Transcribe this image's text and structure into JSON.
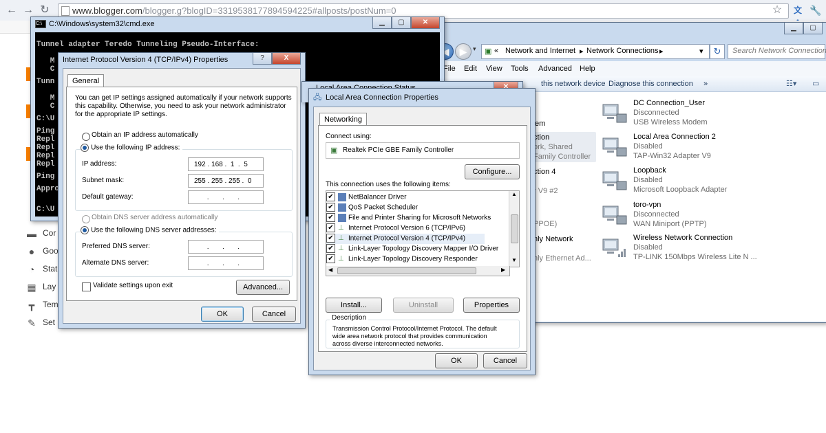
{
  "browser": {
    "url_host": "www.blogger.com",
    "url_rest": "/blogger.g?blogID=3319538177894594225#allposts/postNum=0"
  },
  "blogger_sidebar": {
    "items": [
      "Comments",
      "Google+",
      "Stats",
      "Layout",
      "Template",
      "Settings"
    ],
    "items_visible": [
      "Cor",
      "Goo",
      "Stat",
      "Lay",
      "Tem",
      "Set"
    ]
  },
  "cmd": {
    "title": "C:\\Windows\\system32\\cmd.exe",
    "lines": [
      "Tunnel adapter Teredo Tunneling Pseudo-Interface:",
      "",
      "   M",
      "   C",
      "",
      "Tunn",
      "",
      "   M",
      "   C",
      "",
      "C:\\U",
      "",
      "Ping",
      "Repl",
      "Repl",
      "Repl",
      "Repl",
      "",
      "Ping",
      "",
      "Appro",
      "",
      "",
      "C:\\U"
    ]
  },
  "ipv4_dialog": {
    "title": "Internet Protocol Version 4 (TCP/IPv4) Properties",
    "help_button": "?",
    "close_button": "X",
    "tab": "General",
    "intro_line1": "You can get IP settings assigned automatically if your network supports",
    "intro_line2": "this capability. Otherwise, you need to ask your network administrator",
    "intro_line3": "for the appropriate IP settings.",
    "radio_auto_ip": "Obtain an IP address automatically",
    "radio_manual_ip": "Use the following IP address:",
    "ip_label": "IP address:",
    "ip_value": "192 . 168 .  1  .  5",
    "mask_label": "Subnet mask:",
    "mask_value": "255 . 255 . 255 .  0",
    "gateway_label": "Default gateway:",
    "gateway_value": " .       .       .",
    "radio_auto_dns": "Obtain DNS server address automatically",
    "radio_manual_dns": "Use the following DNS server addresses:",
    "pref_dns_label": "Preferred DNS server:",
    "pref_dns_value": " .       .       .",
    "alt_dns_label": "Alternate DNS server:",
    "alt_dns_value": " .       .       .",
    "validate_label": "Validate settings upon exit",
    "advanced_button": "Advanced...",
    "ok_button": "OK",
    "cancel_button": "Cancel"
  },
  "lac_dialog": {
    "behind_title": "Local Area Connection Status",
    "title": "Local Area Connection Properties",
    "tab": "Networking",
    "connect_using_label": "Connect using:",
    "adapter": "Realtek PCIe GBE Family Controller",
    "configure_button": "Configure...",
    "items_label": "This connection uses the following items:",
    "items": [
      "NetBalancer Driver",
      "QoS Packet Scheduler",
      "File and Printer Sharing for Microsoft Networks",
      "Internet Protocol Version 6 (TCP/IPv6)",
      "Internet Protocol Version 4 (TCP/IPv4)",
      "Link-Layer Topology Discovery Mapper I/O Driver",
      "Link-Layer Topology Discovery Responder"
    ],
    "install_button": "Install...",
    "uninstall_button": "Uninstall",
    "properties_button": "Properties",
    "description_label": "Description",
    "description_line1": "Transmission Control Protocol/Internet Protocol. The default",
    "description_line2": "wide area network protocol that provides communication",
    "description_line3": "across diverse interconnected networks.",
    "ok_button": "OK",
    "cancel_button": "Cancel"
  },
  "explorer": {
    "breadcrumb_prefix": "«",
    "breadcrumb_1": "Network and Internet",
    "breadcrumb_2": "Network Connections",
    "search_placeholder": "Search Network Connections",
    "menu": [
      "File",
      "Edit",
      "View",
      "Tools",
      "Advanced",
      "Help"
    ],
    "cmd_1": "this network device",
    "cmd_2": "Diagnose this connection",
    "cmd_more": "»",
    "left_fragments": [
      "em",
      "ction",
      "ork, Shared",
      "Family Controller",
      "ction 4",
      "r V9 #2",
      "PPOE)",
      "nly Network",
      "nly Ethernet Ad..."
    ],
    "connections": [
      {
        "name": "DC Connection_User",
        "status": "Disconnected",
        "device": "USB Wireless Modem"
      },
      {
        "name": "Local Area Connection 2",
        "status": "Disabled",
        "device": "TAP-Win32 Adapter V9"
      },
      {
        "name": "Loopback",
        "status": "Disabled",
        "device": "Microsoft Loopback Adapter"
      },
      {
        "name": "toro-vpn",
        "status": "Disconnected",
        "device": "WAN Miniport (PPTP)"
      },
      {
        "name": "Wireless Network Connection",
        "status": "Disabled",
        "device": "TP-LINK 150Mbps Wireless Lite N ..."
      }
    ]
  }
}
